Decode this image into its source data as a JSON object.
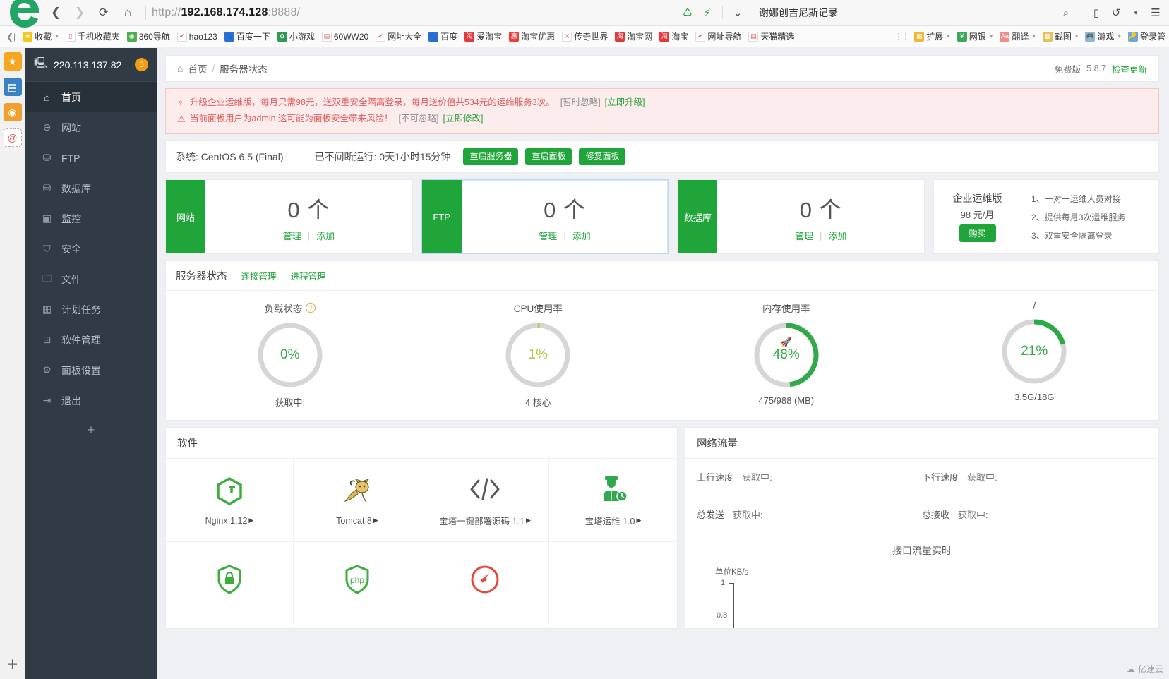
{
  "browser": {
    "url": {
      "scheme": "http://",
      "host": "192.168.174.128",
      "port": ":8888/"
    },
    "search_placeholder": "谢娜创吉尼斯记录",
    "bookmarks": [
      {
        "label": "收藏",
        "icon": "star-icon",
        "color": "#f5c518",
        "glyph": "★",
        "caret": true
      },
      {
        "label": "手机收藏夹",
        "icon": "phone-icon",
        "color": "#ffffff",
        "glyph": "▯",
        "caret": false
      },
      {
        "label": "360导航",
        "icon": "compass-icon",
        "color": "#4caf50",
        "glyph": "◉",
        "caret": false
      },
      {
        "label": "hao123",
        "icon": "hao-icon",
        "color": "#ffffff",
        "glyph": "✔",
        "caret": false
      },
      {
        "label": "百度一下",
        "icon": "baidu-icon",
        "color": "#2b6fd4",
        "glyph": "🐾",
        "caret": false
      },
      {
        "label": "小游戏",
        "icon": "game-icon",
        "color": "#2e9b52",
        "glyph": "✿",
        "caret": false
      },
      {
        "label": "60WW20",
        "icon": "page-icon",
        "color": "#ffffff",
        "glyph": "▤",
        "caret": false
      },
      {
        "label": "网址大全",
        "icon": "hao-icon",
        "color": "#ffffff",
        "glyph": "✔",
        "caret": false
      },
      {
        "label": "百度",
        "icon": "baidu-icon",
        "color": "#2b6fd4",
        "glyph": "🐾",
        "caret": false
      },
      {
        "label": "爱淘宝",
        "icon": "taobao-icon",
        "color": "#e4393c",
        "glyph": "淘",
        "caret": false
      },
      {
        "label": "淘宝优惠",
        "icon": "taobao-icon",
        "color": "#f03c3c",
        "glyph": "惠",
        "caret": false
      },
      {
        "label": "传奇世界",
        "icon": "sword-icon",
        "color": "#ffffff",
        "glyph": "⚔",
        "caret": false
      },
      {
        "label": "淘宝网",
        "icon": "taobao-icon",
        "color": "#e4393c",
        "glyph": "淘",
        "caret": false
      },
      {
        "label": "淘宝",
        "icon": "taobao-icon",
        "color": "#e4393c",
        "glyph": "淘",
        "caret": false
      },
      {
        "label": "网址导航",
        "icon": "hao-icon",
        "color": "#ffffff",
        "glyph": "✔",
        "caret": false
      },
      {
        "label": "天猫精选",
        "icon": "page-icon",
        "color": "#ffffff",
        "glyph": "▤",
        "caret": false
      }
    ],
    "bookmarks_right": [
      {
        "label": "扩展",
        "icon": "extension-icon",
        "color": "#f2b632",
        "glyph": "▦",
        "caret": true
      },
      {
        "label": "网银",
        "icon": "bank-icon",
        "color": "#3aa75b",
        "glyph": "¥",
        "caret": true
      },
      {
        "label": "翻译",
        "icon": "translate-icon",
        "color": "#f28b8b",
        "glyph": "Aa",
        "caret": true
      },
      {
        "label": "截图",
        "icon": "screenshot-icon",
        "color": "#e8c05a",
        "glyph": "▩",
        "caret": true
      },
      {
        "label": "游戏",
        "icon": "gamepad-icon",
        "color": "#8fb8d6",
        "glyph": "🎮",
        "caret": true
      },
      {
        "label": "登录管",
        "icon": "key-icon",
        "color": "#6fa8dc",
        "glyph": "🔑",
        "caret": false
      }
    ]
  },
  "sidebar": {
    "server_ip": "220.113.137.82",
    "badge": "0",
    "items": [
      {
        "label": "首页",
        "icon": "home-icon",
        "glyph": "⌂",
        "active": true
      },
      {
        "label": "网站",
        "icon": "globe-icon",
        "glyph": "⊕",
        "active": false
      },
      {
        "label": "FTP",
        "icon": "server-icon",
        "glyph": "⛁",
        "active": false
      },
      {
        "label": "数据库",
        "icon": "database-icon",
        "glyph": "⛁",
        "active": false
      },
      {
        "label": "监控",
        "icon": "monitor-chart-icon",
        "glyph": "▣",
        "active": false
      },
      {
        "label": "安全",
        "icon": "shield-icon",
        "glyph": "⛉",
        "active": false
      },
      {
        "label": "文件",
        "icon": "folder-icon",
        "glyph": "🗀",
        "active": false
      },
      {
        "label": "计划任务",
        "icon": "calendar-icon",
        "glyph": "▦",
        "active": false
      },
      {
        "label": "软件管理",
        "icon": "apps-icon",
        "glyph": "⊞",
        "active": false
      },
      {
        "label": "面板设置",
        "icon": "gear-icon",
        "glyph": "⚙",
        "active": false
      },
      {
        "label": "退出",
        "icon": "logout-icon",
        "glyph": "⇥",
        "active": false
      }
    ],
    "add_label": "+"
  },
  "breadcrumb": {
    "home": "首页",
    "sep": "/",
    "current": "服务器状态"
  },
  "version": {
    "edition": "免费版",
    "number": "5.8.7",
    "check_update": "检查更新"
  },
  "alerts": [
    {
      "icon": "lightbulb-icon",
      "text": "升级企业运维版，每月只需98元，送双重安全隔离登录，每月送价值共534元的运维服务3次。",
      "action_ignore": "[暂时忽略]",
      "action_do": "[立即升级]"
    },
    {
      "icon": "warning-icon",
      "text": "当前面板用户为admin,这可能为面板安全带来风险！",
      "action_ignore": "[不可忽略]",
      "action_do": "[立即修改]"
    }
  ],
  "system": {
    "os_label": "系统: CentOS 6.5 (Final)",
    "uptime_label": "已不间断运行: 0天1小时15分钟",
    "buttons": [
      "重启服务器",
      "重启面板",
      "修复面板"
    ]
  },
  "stats": [
    {
      "tab": "网站",
      "count": "0 个",
      "manage": "管理",
      "add": "添加",
      "highlight": false
    },
    {
      "tab": "FTP",
      "count": "0 个",
      "manage": "管理",
      "add": "添加",
      "highlight": true
    },
    {
      "tab": "数据库",
      "count": "0 个",
      "manage": "管理",
      "add": "添加",
      "highlight": false
    }
  ],
  "promo": {
    "title": "企业运维版",
    "price": "98 元/月",
    "buy": "购买",
    "benefits": [
      "1、一对一运维人员对接",
      "2、提供每月3次运维服务",
      "3、双重安全隔离登录"
    ]
  },
  "server_status": {
    "title": "服务器状态",
    "links": [
      "连接管理",
      "进程管理"
    ],
    "gauges": [
      {
        "label": "负载状态",
        "value": "0%",
        "percent": 0,
        "caption": "获取中:",
        "has_help": true,
        "color": "#35a84b",
        "rocket": false
      },
      {
        "label": "CPU使用率",
        "value": "1%",
        "percent": 1,
        "caption": "4 核心",
        "has_help": false,
        "color": "#b9c238",
        "rocket": false
      },
      {
        "label": "内存使用率",
        "value": "48%",
        "percent": 48,
        "caption": "475/988 (MB)",
        "has_help": false,
        "color": "#35a84b",
        "rocket": true
      },
      {
        "label": "/",
        "value": "21%",
        "percent": 21,
        "caption": "3.5G/18G",
        "has_help": false,
        "color": "#2bab47",
        "rocket": false
      }
    ]
  },
  "software": {
    "title": "软件",
    "items": [
      {
        "name": "Nginx 1.12",
        "icon": "nginx-icon"
      },
      {
        "name": "Tomcat 8",
        "icon": "tomcat-icon"
      },
      {
        "name": "宝塔一键部署源码 1.1",
        "icon": "code-icon"
      },
      {
        "name": "宝塔运维 1.0",
        "icon": "ops-icon"
      },
      {
        "name": "",
        "icon": "lock-icon"
      },
      {
        "name": "",
        "icon": "php-icon"
      },
      {
        "name": "",
        "icon": "speed-icon"
      },
      {
        "name": "",
        "icon": "blank-icon"
      }
    ]
  },
  "network": {
    "title": "网络流量",
    "rows": [
      {
        "left_key": "上行速度",
        "left_val": "获取中:",
        "right_key": "下行速度",
        "right_val": "获取中:"
      },
      {
        "left_key": "总发送",
        "left_val": "获取中:",
        "right_key": "总接收",
        "right_val": "获取中:"
      }
    ],
    "chart_title": "接口流量实时",
    "chart_unit": "单位KB/s"
  },
  "chart_data": {
    "type": "line",
    "title": "接口流量实时",
    "ylabel": "单位KB/s",
    "xlabel": "",
    "series": [],
    "yticks": [
      "1",
      "0.8"
    ],
    "ylim": [
      0,
      1
    ],
    "grid": false,
    "legend": "none"
  },
  "watermark": "亿速云"
}
